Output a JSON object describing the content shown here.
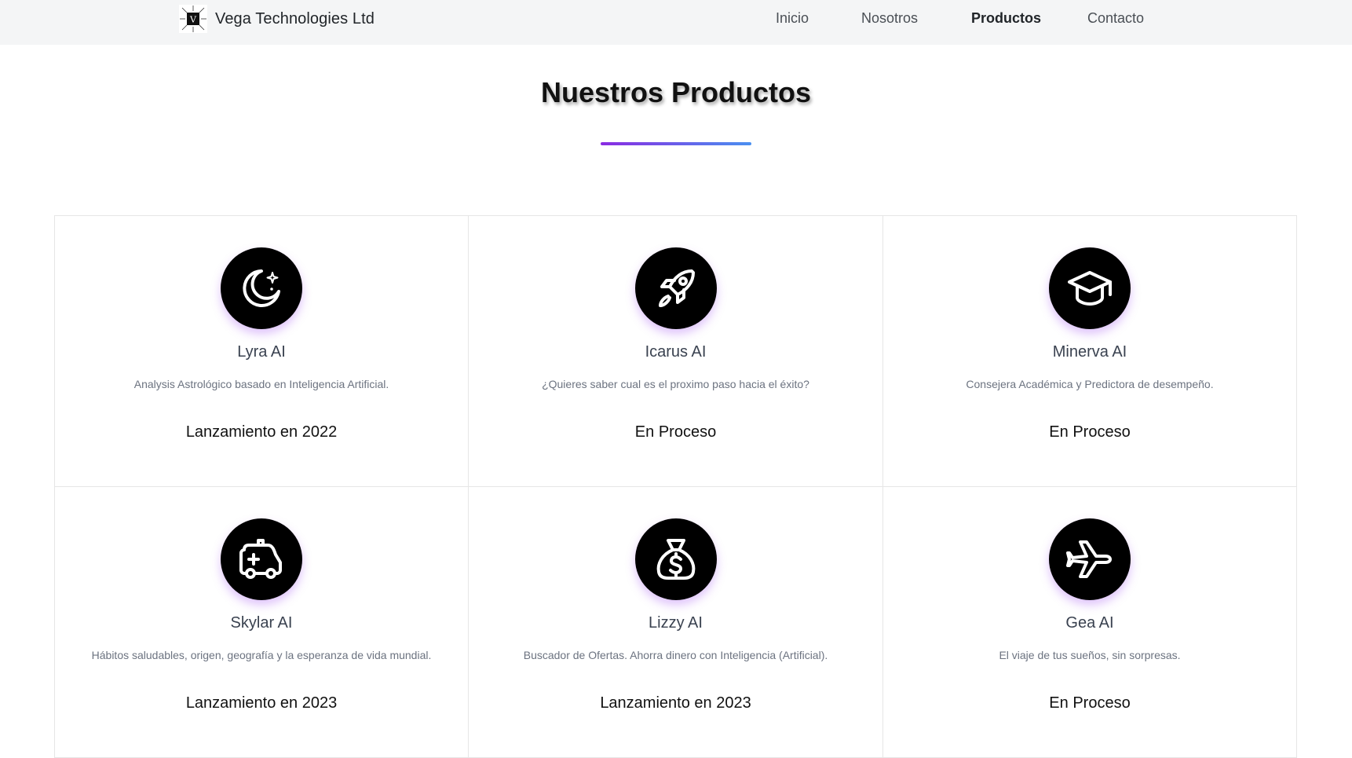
{
  "header": {
    "brand_logo_letter": "V",
    "brand_name": "Vega Technologies Ltd",
    "nav": [
      {
        "label": "Inicio",
        "active": false
      },
      {
        "label": "Nosotros",
        "active": false
      },
      {
        "label": "Productos",
        "active": true
      },
      {
        "label": "Contacto",
        "active": false
      }
    ]
  },
  "section": {
    "title": "Nuestros Productos",
    "underline_colors": [
      "#8a2be2",
      "#4a90f0"
    ]
  },
  "products": [
    {
      "icon": "moon-stars-icon",
      "name": "Lyra AI",
      "description": "Analysis Astrológico basado en Inteligencia Artificial.",
      "status": "Lanzamiento en 2022"
    },
    {
      "icon": "rocket-icon",
      "name": "Icarus AI",
      "description": "¿Quieres saber cual es el proximo paso hacia el éxito?",
      "status": "En Proceso"
    },
    {
      "icon": "graduation-cap-icon",
      "name": "Minerva AI",
      "description": "Consejera Académica y Predictora de desempeño.",
      "status": "En Proceso"
    },
    {
      "icon": "ambulance-icon",
      "name": "Skylar AI",
      "description": "Hábitos saludables, origen, geografía y la esperanza de vida mundial.",
      "status": "Lanzamiento en 2023"
    },
    {
      "icon": "money-bag-icon",
      "name": "Lizzy AI",
      "description": "Buscador de Ofertas. Ahorra dinero con Inteligencia (Artificial).",
      "status": "Lanzamiento en 2023"
    },
    {
      "icon": "plane-icon",
      "name": "Gea AI",
      "description": "El viaje de tus sueños, sin sorpresas.",
      "status": "En Proceso"
    }
  ]
}
